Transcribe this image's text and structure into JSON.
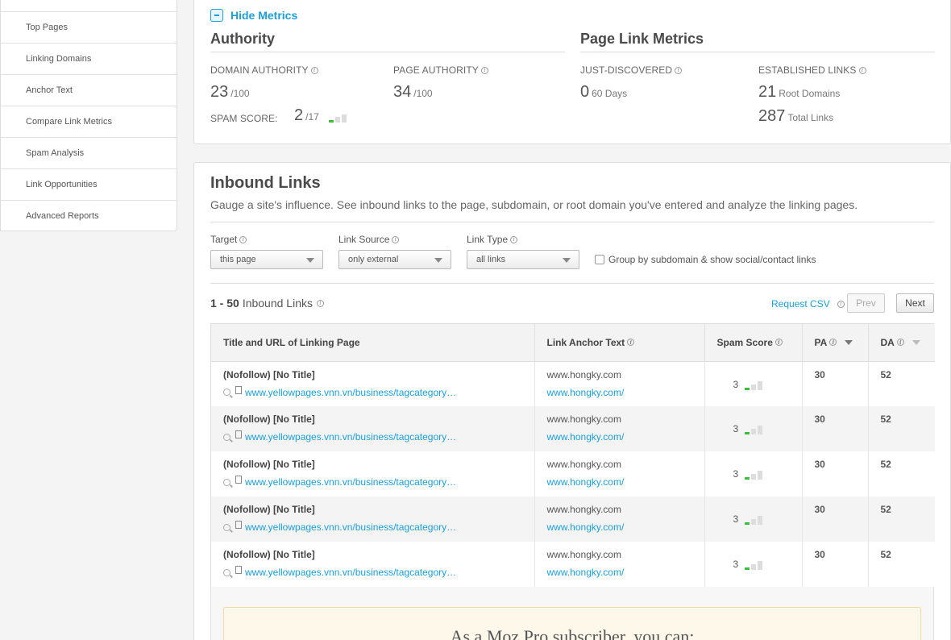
{
  "sidebar": {
    "items": [
      {
        "label": "Top Pages"
      },
      {
        "label": "Linking Domains"
      },
      {
        "label": "Anchor Text"
      },
      {
        "label": "Compare Link Metrics"
      },
      {
        "label": "Spam Analysis"
      },
      {
        "label": "Link Opportunities"
      },
      {
        "label": "Advanced Reports"
      }
    ]
  },
  "metrics": {
    "hide_label": "Hide Metrics",
    "authority": {
      "title": "Authority",
      "domain_authority_label": "DOMAIN AUTHORITY",
      "domain_authority_value": "23",
      "domain_authority_max": "/100",
      "page_authority_label": "PAGE AUTHORITY",
      "page_authority_value": "34",
      "page_authority_max": "/100",
      "spam_score_label": "SPAM SCORE:",
      "spam_score_value": "2",
      "spam_score_max": "/17"
    },
    "page_link": {
      "title": "Page Link Metrics",
      "just_discovered_label": "JUST-DISCOVERED",
      "just_discovered_value": "0",
      "just_discovered_unit": "60 Days",
      "established_label": "ESTABLISHED LINKS",
      "root_domains_value": "21",
      "root_domains_unit": "Root Domains",
      "total_links_value": "287",
      "total_links_unit": "Total Links"
    }
  },
  "inbound": {
    "title": "Inbound Links",
    "subtitle": "Gauge a site's influence. See inbound links to the page, subdomain, or root domain you've entered and analyze the linking pages.",
    "filters": {
      "target_label": "Target",
      "target_value": "this page",
      "source_label": "Link Source",
      "source_value": "only external",
      "type_label": "Link Type",
      "type_value": "all links",
      "group_label": "Group by subdomain & show social/contact links"
    },
    "range": "1 - 50",
    "range_label": "Inbound Links",
    "request_csv": "Request CSV",
    "prev": "Prev",
    "next": "Next",
    "columns": {
      "title_url": "Title and URL of Linking Page",
      "anchor": "Link Anchor Text",
      "spam": "Spam Score",
      "pa": "PA",
      "da": "DA"
    },
    "rows": [
      {
        "title": "(Nofollow) [No Title]",
        "url": "www.yellowpages.vnn.vn/business/tagcategory…",
        "anchor_text": "www.hongky.com",
        "anchor_url": "www.hongky.com/",
        "spam": "3",
        "pa": "30",
        "da": "52"
      },
      {
        "title": "(Nofollow) [No Title]",
        "url": "www.yellowpages.vnn.vn/business/tagcategory…",
        "anchor_text": "www.hongky.com",
        "anchor_url": "www.hongky.com/",
        "spam": "3",
        "pa": "30",
        "da": "52"
      },
      {
        "title": "(Nofollow) [No Title]",
        "url": "www.yellowpages.vnn.vn/business/tagcategory…",
        "anchor_text": "www.hongky.com",
        "anchor_url": "www.hongky.com/",
        "spam": "3",
        "pa": "30",
        "da": "52"
      },
      {
        "title": "(Nofollow) [No Title]",
        "url": "www.yellowpages.vnn.vn/business/tagcategory…",
        "anchor_text": "www.hongky.com",
        "anchor_url": "www.hongky.com/",
        "spam": "3",
        "pa": "30",
        "da": "52"
      },
      {
        "title": "(Nofollow) [No Title]",
        "url": "www.yellowpages.vnn.vn/business/tagcategory…",
        "anchor_text": "www.hongky.com",
        "anchor_url": "www.hongky.com/",
        "spam": "3",
        "pa": "30",
        "da": "52"
      }
    ],
    "upsell": "As a Moz Pro subscriber, you can:"
  },
  "colors": {
    "accent": "#1d9ed7",
    "spam_bar_on": "#3fbb3f",
    "spam_bar_off": "#dddddd"
  },
  "icons": [
    "minus-square-icon",
    "info-icon",
    "search-icon",
    "document-icon",
    "caret-down-icon"
  ]
}
